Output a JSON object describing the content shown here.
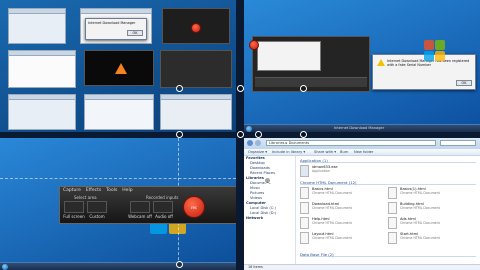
{
  "q1": {
    "dialog_text": "Internet Download Manager",
    "dialog_button": "OK"
  },
  "q2": {
    "dialog_text": "Internet Download Manager has been registered with a fake Serial Number",
    "dialog_button": "OK",
    "taskbar_label": "Internet Download Manager"
  },
  "tool": {
    "menu": [
      "Capture",
      "Effects",
      "Tools",
      "Help"
    ],
    "header_left": "Select area",
    "header_right": "Recorded inputs",
    "buttons": [
      "Full screen",
      "Custom",
      "Webcam off",
      "Audio off"
    ],
    "rec_label": "rec"
  },
  "explorer": {
    "address": "Libraries ▸ Documents",
    "toolbar": [
      "Organize ▾",
      "Include in library ▾",
      "Share with ▾",
      "Burn",
      "New folder"
    ],
    "nav": [
      {
        "label": "Favorites",
        "group": true
      },
      {
        "label": "Desktop",
        "group": false
      },
      {
        "label": "Downloads",
        "group": false
      },
      {
        "label": "Recent Places",
        "group": false
      },
      {
        "label": "Libraries",
        "group": true
      },
      {
        "label": "Documents",
        "group": false
      },
      {
        "label": "Music",
        "group": false
      },
      {
        "label": "Pictures",
        "group": false
      },
      {
        "label": "Videos",
        "group": false
      },
      {
        "label": "Computer",
        "group": true
      },
      {
        "label": "Local Disk (C:)",
        "group": false
      },
      {
        "label": "Local Disk (D:)",
        "group": false
      },
      {
        "label": "Network",
        "group": true
      }
    ],
    "group1": "Application (1)",
    "group2": "Chrome HTML Document (12)",
    "group3": "Data Base File (2)",
    "files": [
      {
        "name": "idman633.exe",
        "type": "Application"
      },
      {
        "name": "Basics.html",
        "type": "Chrome HTML Document"
      },
      {
        "name": "Basics(1).html",
        "type": "Chrome HTML Document"
      },
      {
        "name": "Download.html",
        "type": "Chrome HTML Document"
      },
      {
        "name": "Building.html",
        "type": "Chrome HTML Document"
      },
      {
        "name": "Help.html",
        "type": "Chrome HTML Document"
      },
      {
        "name": "Ads.html",
        "type": "Chrome HTML Document"
      },
      {
        "name": "Layout.html",
        "type": "Chrome HTML Document"
      },
      {
        "name": "Start.html",
        "type": "Chrome HTML Document"
      }
    ],
    "status": "16 items"
  }
}
